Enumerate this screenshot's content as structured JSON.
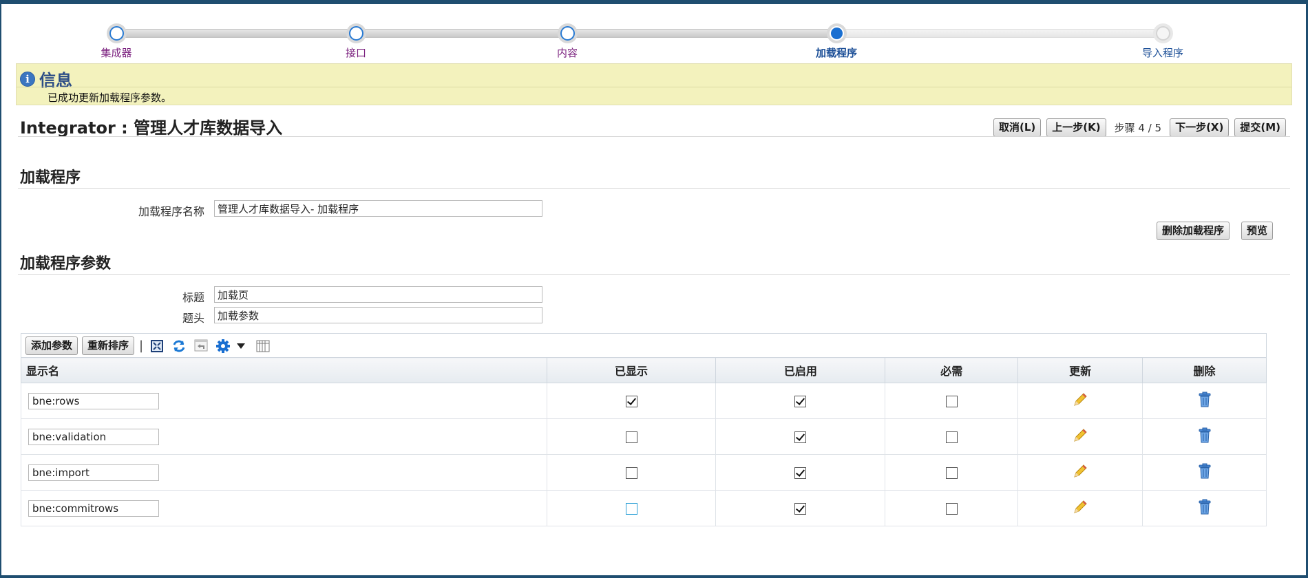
{
  "train": {
    "steps": [
      {
        "label": "集成器",
        "state": "visited"
      },
      {
        "label": "接口",
        "state": "visited"
      },
      {
        "label": "内容",
        "state": "visited"
      },
      {
        "label": "加载程序",
        "state": "current"
      },
      {
        "label": "导入程序",
        "state": "future"
      }
    ]
  },
  "info": {
    "title": "信息",
    "message": "已成功更新加载程序参数。"
  },
  "header": {
    "title": "Integrator : 管理人才库数据导入",
    "cancel": "取消(L)",
    "back": "上一步(K)",
    "step_text": "步骤 4 / 5",
    "next": "下一步(X)",
    "submit": "提交(M)"
  },
  "loader": {
    "section_title": "加载程序",
    "name_label": "加载程序名称",
    "name_value": "管理人才库数据导入- 加载程序",
    "delete_button": "删除加载程序",
    "preview_button": "预览"
  },
  "params": {
    "section_title": "加载程序参数",
    "title_label": "标题",
    "title_value": "加载页",
    "header_label": "题头",
    "header_value": "加载参数",
    "add_button": "添加参数",
    "reorder_button": "重新排序",
    "columns": [
      "显示名",
      "已显示",
      "已启用",
      "必需",
      "更新",
      "删除"
    ],
    "rows": [
      {
        "name": "bne:rows",
        "displayed": true,
        "enabled": true,
        "required": false
      },
      {
        "name": "bne:validation",
        "displayed": false,
        "enabled": true,
        "required": false
      },
      {
        "name": "bne:import",
        "displayed": false,
        "enabled": true,
        "required": false
      },
      {
        "name": "bne:commitrows",
        "displayed": false,
        "enabled": true,
        "required": false
      }
    ]
  },
  "icons": {
    "info": "info-icon",
    "toolbar": [
      "detach-icon",
      "refresh-icon",
      "undo-icon",
      "settings-icon",
      "dropdown-icon",
      "columns-icon"
    ],
    "update": "pencil-icon",
    "delete": "trash-icon"
  },
  "colors": {
    "accent": "#1a6fd1",
    "visited_label": "#7a1f7e",
    "info_background": "#f3f2bd",
    "frame": "#1f4e70"
  }
}
